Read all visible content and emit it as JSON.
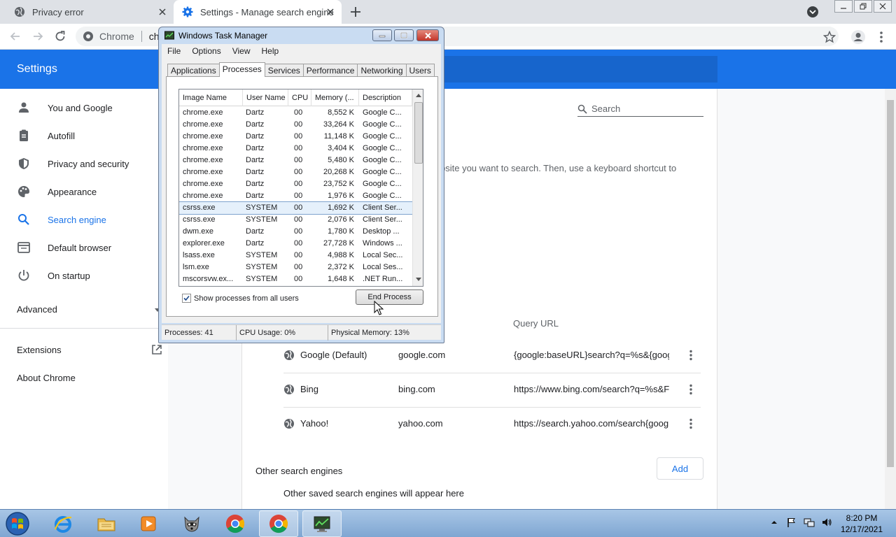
{
  "browser": {
    "tabs": [
      {
        "title": "Privacy error",
        "active": false
      },
      {
        "title": "Settings - Manage search engine",
        "active": true
      }
    ],
    "omnibox": {
      "scheme_label": "Chrome",
      "url": "chr"
    }
  },
  "settings": {
    "title": "Settings",
    "search_placeholder": "Search",
    "sidebar": {
      "items": [
        {
          "label": "You and Google",
          "icon": "person-icon",
          "active": false
        },
        {
          "label": "Autofill",
          "icon": "clipboard-icon",
          "active": false
        },
        {
          "label": "Privacy and security",
          "icon": "shield-icon",
          "active": false
        },
        {
          "label": "Appearance",
          "icon": "palette-icon",
          "active": false
        },
        {
          "label": "Search engine",
          "icon": "search-icon",
          "active": true
        },
        {
          "label": "Default browser",
          "icon": "browser-icon",
          "active": false
        },
        {
          "label": "On startup",
          "icon": "power-icon",
          "active": false
        }
      ],
      "advanced": "Advanced",
      "extensions": "Extensions",
      "about": "About Chrome"
    },
    "description_fragment": "bsite you want to search. Then, use a keyboard shortcut to",
    "query_url_header": "Query URL",
    "engines": [
      {
        "name": "Google (Default)",
        "keyword": "google.com",
        "url": "{google:baseURL}search?q=%s&{googl"
      },
      {
        "name": "Bing",
        "keyword": "bing.com",
        "url": "https://www.bing.com/search?q=%s&F"
      },
      {
        "name": "Yahoo!",
        "keyword": "yahoo.com",
        "url": "https://search.yahoo.com/search{goog"
      }
    ],
    "other_title": "Other search engines",
    "add_label": "Add",
    "other_empty": "Other saved search engines will appear here"
  },
  "task_manager": {
    "title": "Windows Task Manager",
    "menu": [
      "File",
      "Options",
      "View",
      "Help"
    ],
    "tabs": [
      {
        "label": "Applications",
        "active": false
      },
      {
        "label": "Processes",
        "active": true
      },
      {
        "label": "Services",
        "active": false
      },
      {
        "label": "Performance",
        "active": false
      },
      {
        "label": "Networking",
        "active": false
      },
      {
        "label": "Users",
        "active": false
      }
    ],
    "columns": {
      "name": "Image Name",
      "user": "User Name",
      "cpu": "CPU",
      "memory": "Memory (...",
      "description": "Description"
    },
    "processes": [
      {
        "name": "chrome.exe",
        "user": "Dartz",
        "cpu": "00",
        "memory": "8,552 K",
        "description": "Google C..."
      },
      {
        "name": "chrome.exe",
        "user": "Dartz",
        "cpu": "00",
        "memory": "33,264 K",
        "description": "Google C..."
      },
      {
        "name": "chrome.exe",
        "user": "Dartz",
        "cpu": "00",
        "memory": "11,148 K",
        "description": "Google C..."
      },
      {
        "name": "chrome.exe",
        "user": "Dartz",
        "cpu": "00",
        "memory": "3,404 K",
        "description": "Google C..."
      },
      {
        "name": "chrome.exe",
        "user": "Dartz",
        "cpu": "00",
        "memory": "5,480 K",
        "description": "Google C..."
      },
      {
        "name": "chrome.exe",
        "user": "Dartz",
        "cpu": "00",
        "memory": "20,268 K",
        "description": "Google C..."
      },
      {
        "name": "chrome.exe",
        "user": "Dartz",
        "cpu": "00",
        "memory": "23,752 K",
        "description": "Google C..."
      },
      {
        "name": "chrome.exe",
        "user": "Dartz",
        "cpu": "00",
        "memory": "1,976 K",
        "description": "Google C..."
      },
      {
        "name": "csrss.exe",
        "user": "SYSTEM",
        "cpu": "00",
        "memory": "1,692 K",
        "description": "Client Ser...",
        "selected": true
      },
      {
        "name": "csrss.exe",
        "user": "SYSTEM",
        "cpu": "00",
        "memory": "2,076 K",
        "description": "Client Ser..."
      },
      {
        "name": "dwm.exe",
        "user": "Dartz",
        "cpu": "00",
        "memory": "1,780 K",
        "description": "Desktop ..."
      },
      {
        "name": "explorer.exe",
        "user": "Dartz",
        "cpu": "00",
        "memory": "27,728 K",
        "description": "Windows ..."
      },
      {
        "name": "lsass.exe",
        "user": "SYSTEM",
        "cpu": "00",
        "memory": "4,988 K",
        "description": "Local Sec..."
      },
      {
        "name": "lsm.exe",
        "user": "SYSTEM",
        "cpu": "00",
        "memory": "2,372 K",
        "description": "Local Ses..."
      },
      {
        "name": "mscorsvw.ex...",
        "user": "SYSTEM",
        "cpu": "00",
        "memory": "1,648 K",
        "description": ".NET Run..."
      }
    ],
    "show_all_users_label": "Show processes from all users",
    "show_all_users_checked": true,
    "end_process_label": "End Process",
    "status": {
      "processes": "Processes: 41",
      "cpu": "CPU Usage: 0%",
      "memory": "Physical Memory: 13%"
    }
  },
  "taskbar": {
    "apps": [
      "internet-explorer-icon",
      "file-explorer-icon",
      "media-player-icon",
      "raccoon-app-icon",
      "chrome-icon",
      "chrome-icon",
      "task-manager-icon"
    ],
    "clock_time": "8:20 PM",
    "clock_date": "12/17/2021"
  },
  "colors": {
    "accent": "#1a73e8",
    "selection": "#e5f0fb"
  }
}
